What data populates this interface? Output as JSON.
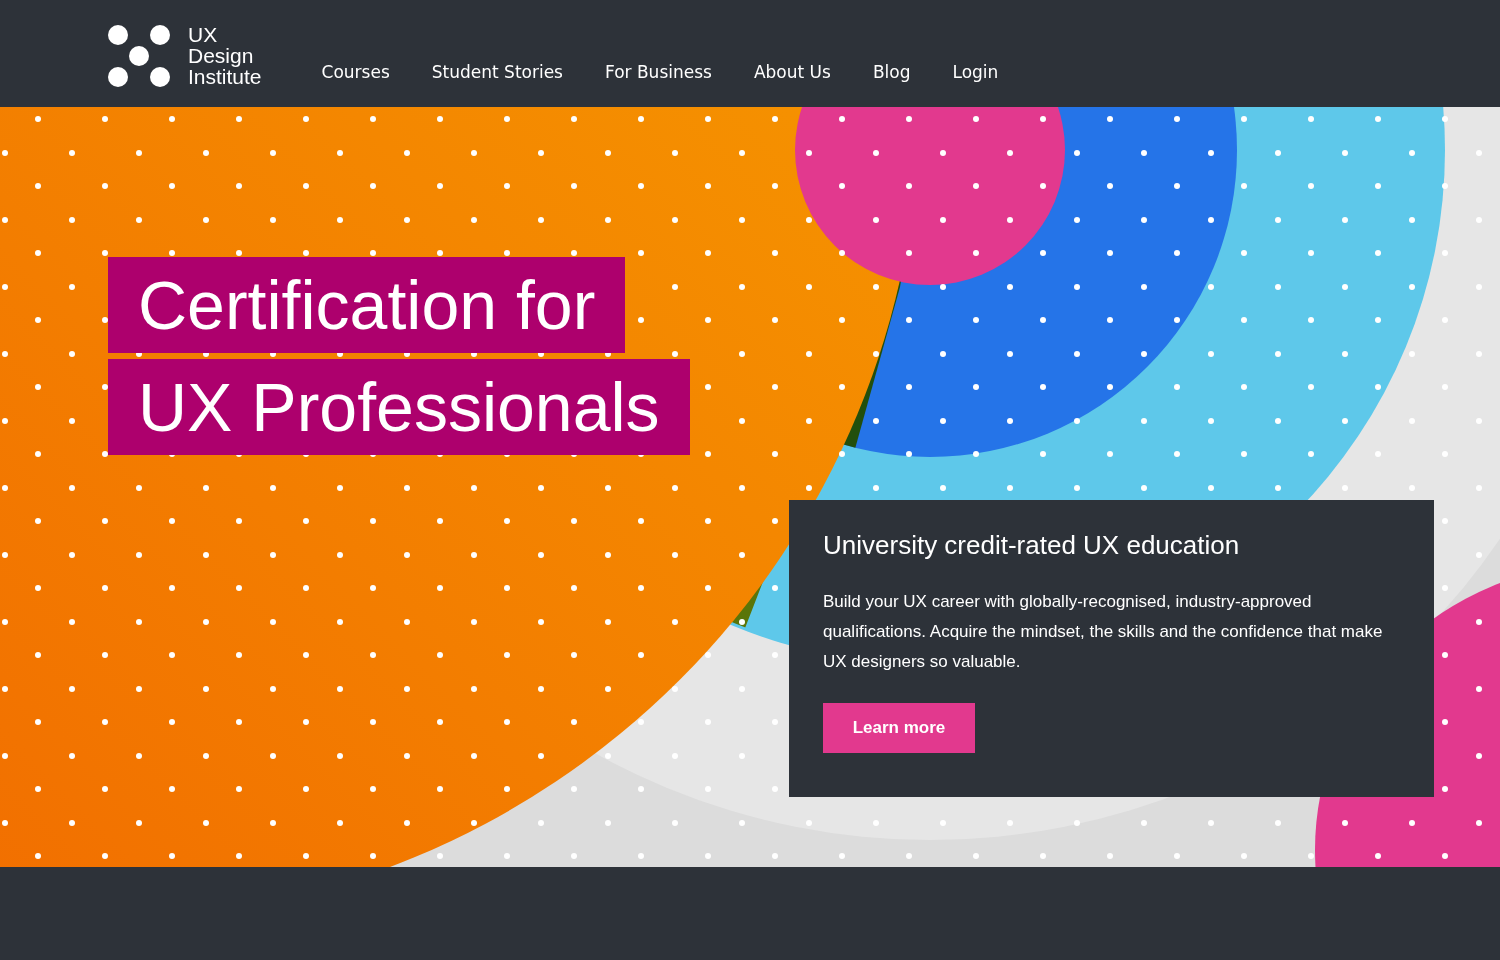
{
  "logo": {
    "lines": [
      "UX",
      "Design",
      "Institute"
    ]
  },
  "nav": [
    {
      "label": "Courses"
    },
    {
      "label": "Student Stories"
    },
    {
      "label": "For Business"
    },
    {
      "label": "About Us"
    },
    {
      "label": "Blog"
    },
    {
      "label": "Login"
    }
  ],
  "hero": {
    "headline_lines": [
      "Certification for",
      "UX Professionals"
    ],
    "card": {
      "title": "University credit-rated UX education",
      "body": "Build your UX career with globally-recognised, industry-approved qualifications. Acquire the mindset, the skills and the confidence that make UX designers so valuable.",
      "button": "Learn more"
    }
  }
}
